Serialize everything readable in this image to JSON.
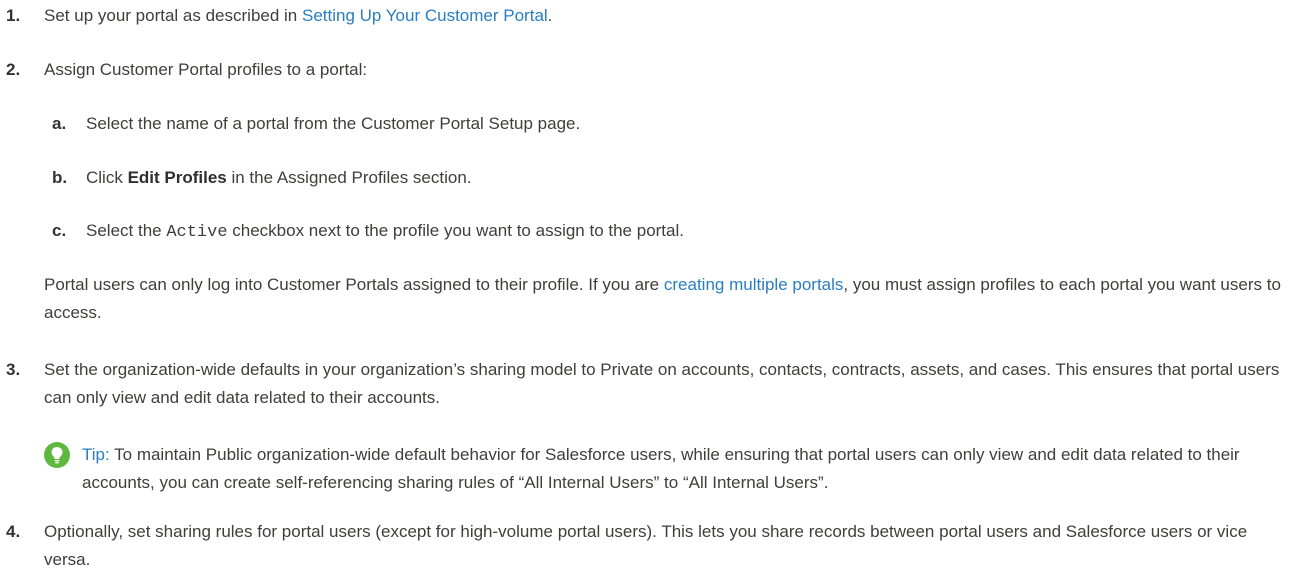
{
  "steps": [
    {
      "num": "1.",
      "pre": "Set up your portal as described in ",
      "link": "Setting Up Your Customer Portal",
      "post": "."
    },
    {
      "num": "2.",
      "text": "Assign Customer Portal profiles to a portal:"
    },
    {
      "num": "3.",
      "text": "Set the organization-wide defaults in your organization’s sharing model to Private on accounts, contacts, contracts, assets, and cases. This ensures that portal users can only view and edit data related to their accounts."
    },
    {
      "num": "4.",
      "text": "Optionally, set sharing rules for portal users (except for high-volume portal users). This lets you share records between portal users and Salesforce users or vice versa."
    }
  ],
  "substeps": [
    {
      "num": "a.",
      "text": "Select the name of a portal from the Customer Portal Setup page."
    },
    {
      "num": "b.",
      "pre": "Click ",
      "bold": "Edit Profiles",
      "post": " in the Assigned Profiles section."
    },
    {
      "num": "c.",
      "pre": "Select the ",
      "mono": "Active",
      "post": " checkbox next to the profile you want to assign to the portal."
    }
  ],
  "note": {
    "pre": "Portal users can only log into Customer Portals assigned to their profile. If you are ",
    "link": "creating multiple portals",
    "post": ", you must assign profiles to each portal you want users to access."
  },
  "tip": {
    "label": "Tip:",
    "text": " To maintain Public organization-wide default behavior for Salesforce users, while ensuring that portal users can only view and edit data related to their accounts, you can create self-referencing sharing rules of “All Internal Users” to “All Internal Users”.",
    "icon": "lightbulb-icon",
    "color": "#5eb83f"
  }
}
